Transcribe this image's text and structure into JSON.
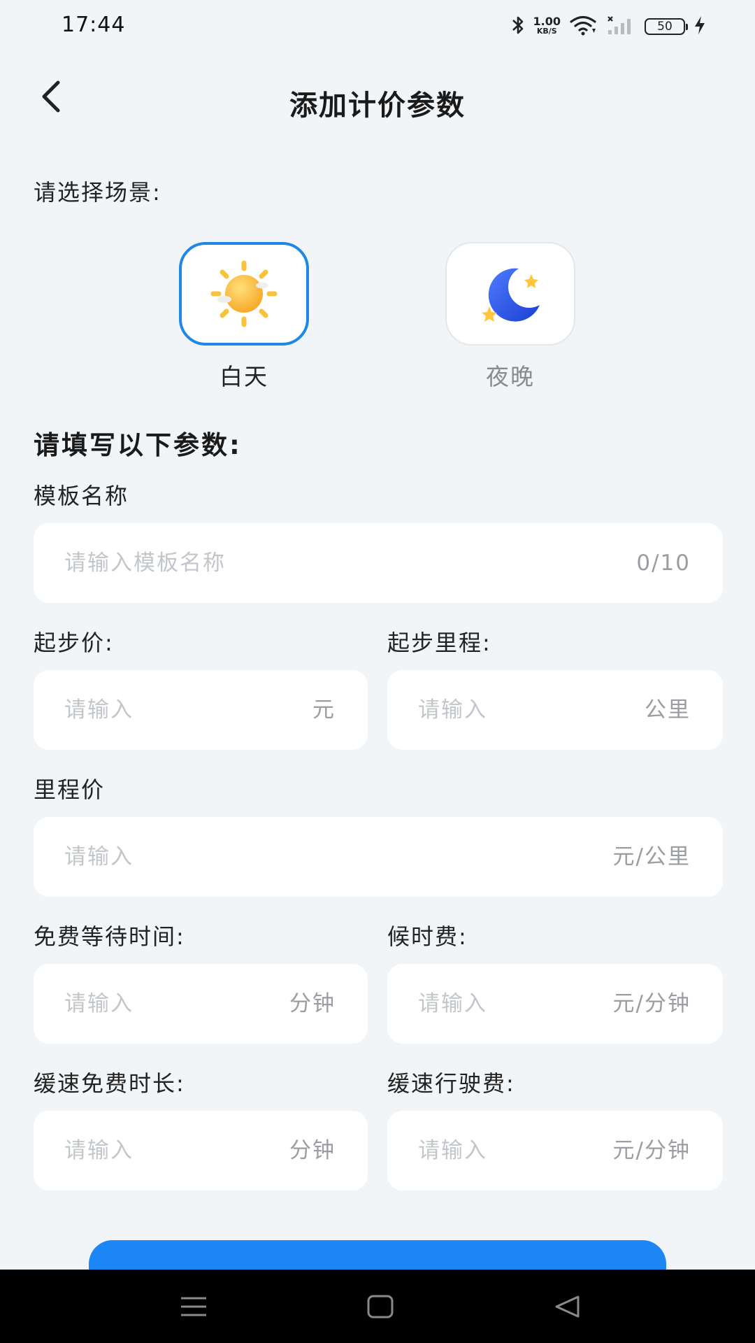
{
  "status_bar": {
    "time": "17:44",
    "net_speed_value": "1.00",
    "net_speed_unit": "KB/S",
    "battery": "50"
  },
  "header": {
    "title": "添加计价参数"
  },
  "scene_section": {
    "label": "请选择场景:",
    "options": [
      {
        "label": "白天",
        "selected": true
      },
      {
        "label": "夜晚",
        "selected": false
      }
    ]
  },
  "form": {
    "heading": "请填写以下参数:",
    "template_name": {
      "label": "模板名称",
      "placeholder": "请输入模板名称",
      "counter": "0/10"
    },
    "start_price": {
      "label": "起步价:",
      "placeholder": "请输入",
      "unit": "元"
    },
    "start_mileage": {
      "label": "起步里程:",
      "placeholder": "请输入",
      "unit": "公里"
    },
    "mileage_price": {
      "label": "里程价",
      "placeholder": "请输入",
      "unit": "元/公里"
    },
    "free_wait_time": {
      "label": "免费等待时间:",
      "placeholder": "请输入",
      "unit": "分钟"
    },
    "wait_fee": {
      "label": "候时费:",
      "placeholder": "请输入",
      "unit": "元/分钟"
    },
    "slow_free_duration": {
      "label": "缓速免费时长:",
      "placeholder": "请输入",
      "unit": "分钟"
    },
    "slow_drive_fee": {
      "label": "缓速行驶费:",
      "placeholder": "请输入",
      "unit": "元/分钟"
    }
  },
  "colors": {
    "accent": "#1f88e5",
    "button": "#1d86f5",
    "background": "#f2f5f7"
  }
}
